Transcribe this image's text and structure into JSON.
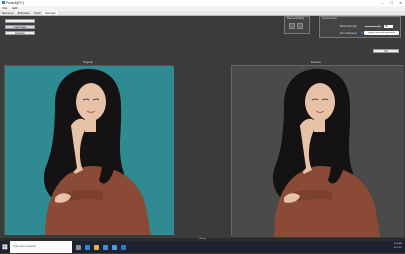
{
  "window": {
    "title": "PhotoAI(PC)",
    "controls": [
      "–",
      "☐",
      "✕"
    ]
  },
  "menu": [
    "File",
    "Edit"
  ],
  "tabs": [
    {
      "label": "Remove",
      "active": false
    },
    {
      "label": "Enhance",
      "active": false
    },
    {
      "label": "Vivid",
      "active": false
    },
    {
      "label": "Settings",
      "active": true
    }
  ],
  "sidebar": {
    "buttons": [
      "",
      "Load Image",
      "Example"
    ]
  },
  "manual_editing": {
    "label": "Manual Editing"
  },
  "ai_controls": {
    "label": "Commentary",
    "mask_strength_label": "Mask Strength",
    "fine_tolerance_label": "Fine Tolerance",
    "mask_strength_value": "80",
    "hint": "Highlight areas with expressions"
  },
  "ok_button": "OK",
  "panels": {
    "original_label": "Original",
    "preview_label": "Preview",
    "original_filename": "RSB073 AI PC"
  },
  "status_bar": "Ready",
  "taskbar": {
    "search_placeholder": "Type here to search",
    "time": "9:30 AM",
    "date": "1/1/2021"
  },
  "colors": {
    "teal_bg": "#2f8a92",
    "sweater": "#8a4a36",
    "skin": "#e8c2a8",
    "hair": "#141212",
    "preview_bg": "#4a4a4a",
    "taskbar": "#1c2230"
  }
}
